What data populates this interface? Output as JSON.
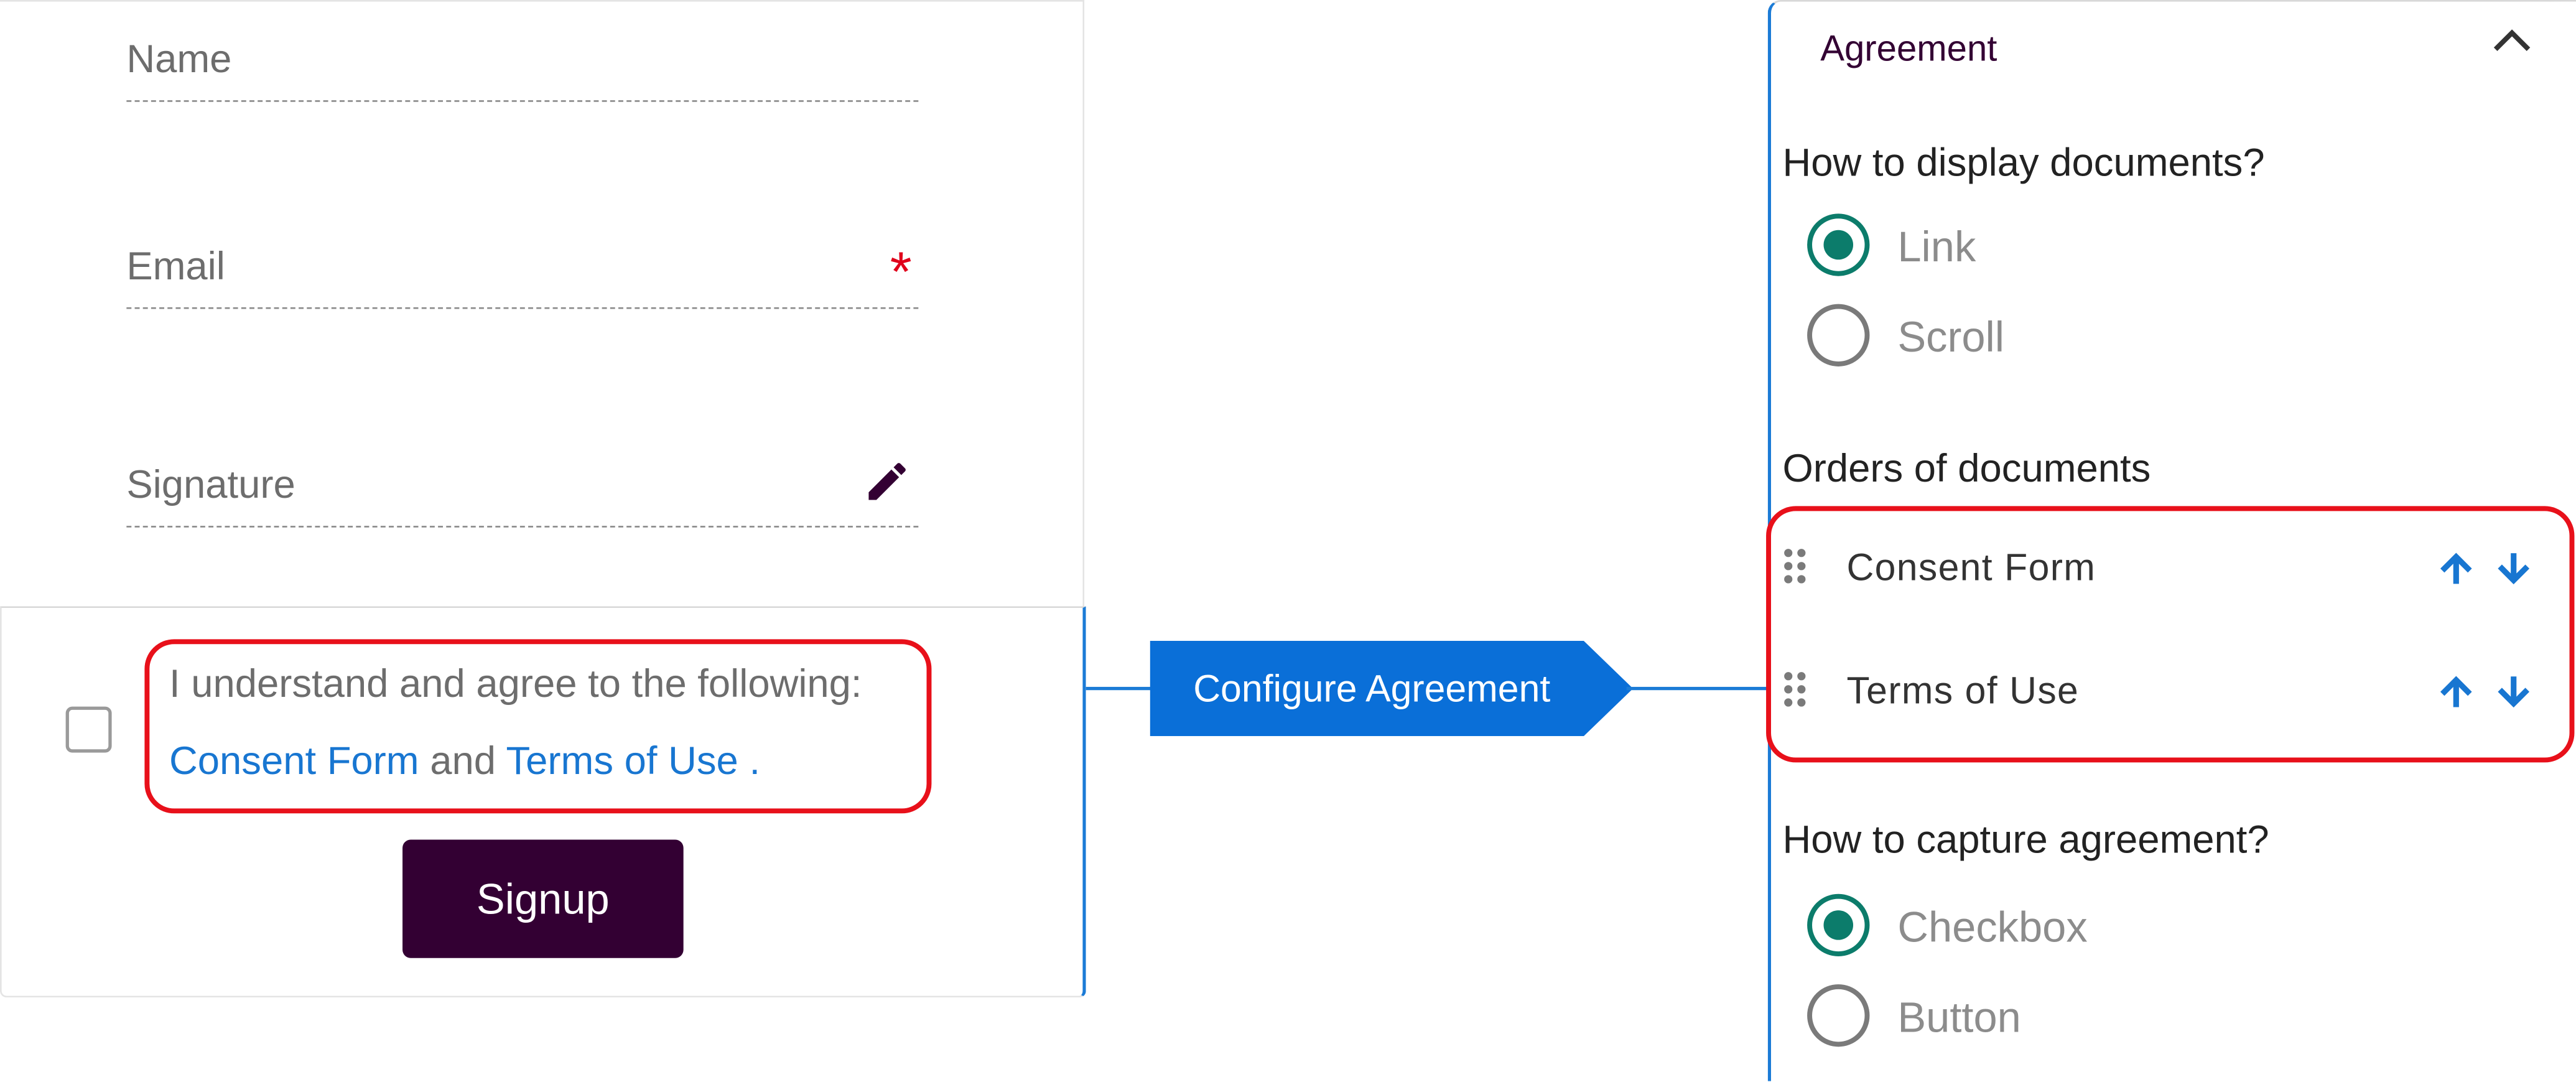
{
  "form": {
    "name_label": "Name",
    "email_label": "Email",
    "email_required": "*",
    "signature_label": "Signature",
    "agreement_prefix": "I understand and agree to the following:",
    "doc_link_1": "Consent Form",
    "conjunction": "and",
    "doc_link_2": "Terms of Use",
    "terminator": ".",
    "signup_label": "Signup"
  },
  "connector": {
    "label": "Configure Agreement"
  },
  "panel": {
    "title": "Agreement",
    "display_question": "How to display documents?",
    "display_options": [
      {
        "label": "Link",
        "selected": true
      },
      {
        "label": "Scroll",
        "selected": false
      }
    ],
    "order_heading": "Orders of documents",
    "documents": [
      "Consent Form",
      "Terms of Use"
    ],
    "capture_question": "How to capture agreement?",
    "capture_options": [
      {
        "label": "Checkbox",
        "selected": true
      },
      {
        "label": "Button",
        "selected": false
      }
    ]
  },
  "colors": {
    "accent_blue": "#1876d1",
    "signup_bg": "#330033",
    "radio_selected": "#0c7c6b",
    "highlight_red": "#e8101a"
  },
  "icons": [
    "pencil-icon",
    "chevron-up-icon",
    "drag-handle-icon",
    "arrow-up-icon",
    "arrow-down-icon"
  ]
}
